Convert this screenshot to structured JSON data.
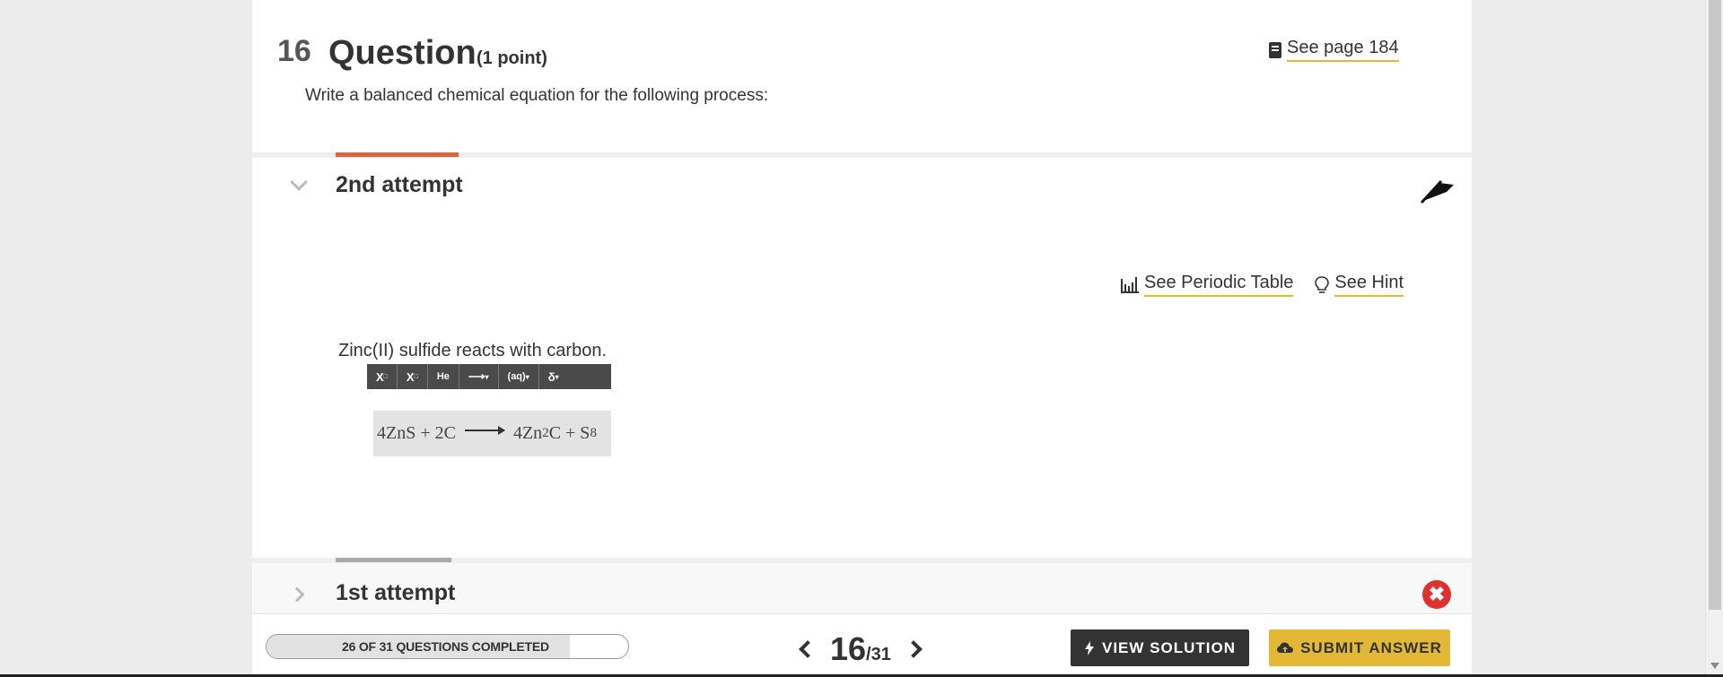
{
  "question": {
    "number": "16",
    "title": "Question",
    "points": "(1 point)",
    "prompt": "Write a balanced chemical equation for the following process:",
    "see_page": "See page 184"
  },
  "attempt2": {
    "title": "2nd attempt",
    "see_periodic_table": "See Periodic Table",
    "see_hint": "See Hint",
    "stem": "Zinc(II) sulfide reacts with carbon.",
    "toolbar": [
      "X",
      "X",
      "He",
      "⟶",
      "(aq)",
      "δ"
    ],
    "answer": {
      "lhs": "4ZnS + 2C",
      "rhs_1": "4Zn",
      "rhs_sub1": "2",
      "rhs_2": "C + S",
      "rhs_sub2": "8"
    }
  },
  "attempt1": {
    "title": "1st attempt",
    "status_icon": "incorrect-x"
  },
  "footer": {
    "progress_label": "26 OF 31 QUESTIONS COMPLETED",
    "progress_fraction": 0.839,
    "current": "16",
    "total": "/31",
    "view_solution": "VIEW SOLUTION",
    "submit_answer": "SUBMIT ANSWER"
  },
  "colors": {
    "accent_orange": "#e0643b",
    "accent_yellow": "#e2b836",
    "error_red": "#e0312f"
  }
}
